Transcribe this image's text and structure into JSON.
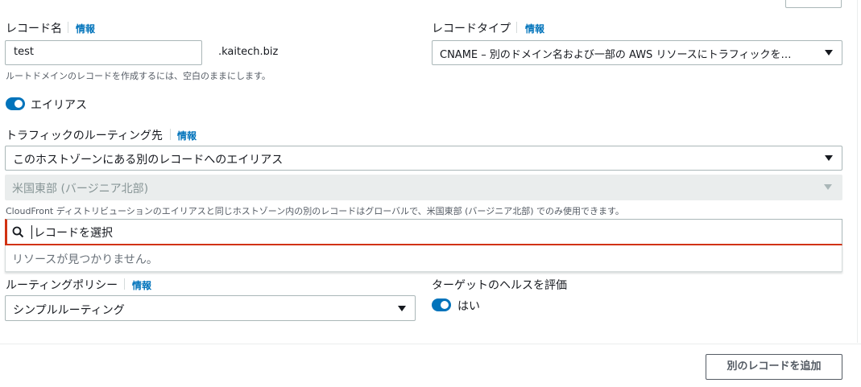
{
  "record_name": {
    "label": "レコード名",
    "info": "情報",
    "value": "test",
    "suffix": ".kaitech.biz",
    "hint": "ルートドメインのレコードを作成するには、空白のままにします。"
  },
  "record_type": {
    "label": "レコードタイプ",
    "info": "情報",
    "selected": "CNAME – 別のドメイン名および一部の AWS リソースにトラフィックを…"
  },
  "alias": {
    "enabled": true,
    "label": "エイリアス"
  },
  "route_traffic": {
    "label": "トラフィックのルーティング先",
    "info": "情報",
    "selected": "このホストゾーンにある別のレコードへのエイリアス",
    "region": "米国東部 (バージニア北部)",
    "hint": "CloudFront ディストリビューションのエイリアスと同じホストゾーン内の別のレコードはグローバルで、米国東部 (バージニア北部) でのみ使用できます。",
    "search_placeholder": "レコードを選択",
    "no_results": "リソースが見つかりません。"
  },
  "routing_policy": {
    "label": "ルーティングポリシー",
    "info": "情報",
    "selected": "シンプルルーティング"
  },
  "health": {
    "label": "ターゲットのヘルスを評価",
    "enabled": true,
    "value_label": "はい"
  },
  "footer": {
    "add_record_button": "別のレコードを追加"
  },
  "colors": {
    "accent": "#0073bb",
    "error": "#d13212",
    "disabled_bg": "#eaeded"
  }
}
